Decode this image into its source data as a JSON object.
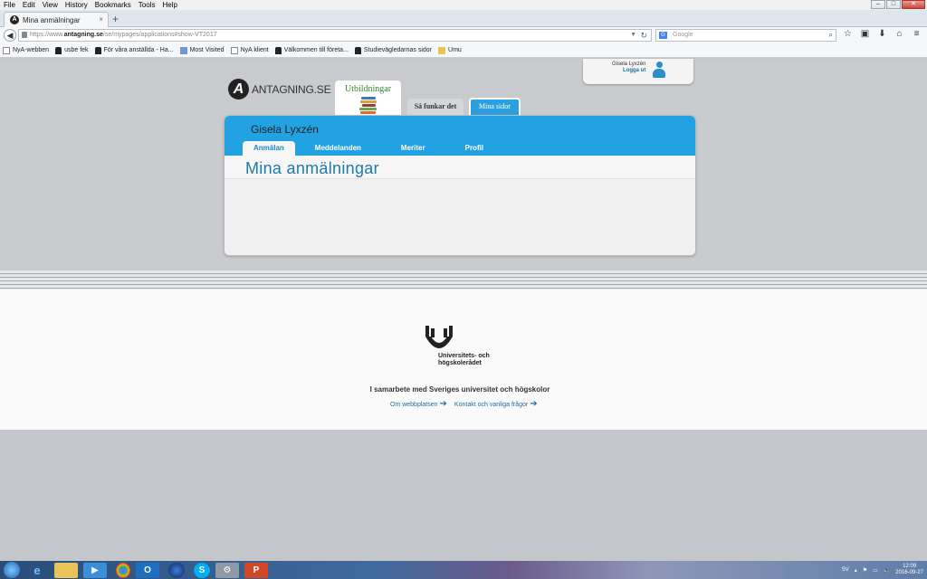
{
  "menu": [
    "File",
    "Edit",
    "View",
    "History",
    "Bookmarks",
    "Tools",
    "Help"
  ],
  "window_controls": {
    "minimize": "–",
    "maximize": "□",
    "close": "✕"
  },
  "browser": {
    "tab_title": "Mina anmälningar",
    "tab_close": "×",
    "new_tab": "+",
    "url_prefix": "https://www.",
    "url_domain": "antagning.se",
    "url_path": "/se/mypages/applications#show-VT2017",
    "search_placeholder": "Google",
    "search_engine_icon": "G"
  },
  "bookmarks": [
    {
      "label": "NyA-webben",
      "icon": "page"
    },
    {
      "label": "usbe fek",
      "icon": "hat"
    },
    {
      "label": "För våra anställda - Ha...",
      "icon": "hat"
    },
    {
      "label": "Most Visited",
      "icon": "blue"
    },
    {
      "label": "NyA klient",
      "icon": "page"
    },
    {
      "label": "Välkommen till företa...",
      "icon": "hat"
    },
    {
      "label": "Studievägledarnas sidor",
      "icon": "hat"
    },
    {
      "label": "Umu",
      "icon": "folder"
    }
  ],
  "site": {
    "logo_letter": "A",
    "logo_text": "ANTAGNING.SE",
    "user_name": "Gisela Lyxzén",
    "logout": "Logga ut",
    "tabs": {
      "utbildningar": "Utbildningar",
      "sa_funkar": "Så funkar det",
      "mina_sidor": "Mina sidor"
    },
    "panel_name": "Gisela Lyxzén",
    "subtabs": [
      "Anmälan",
      "Meddelanden",
      "Meriter",
      "Profil"
    ],
    "panel_title": "Mina anmälningar"
  },
  "footer": {
    "org_line1": "Universitets- och",
    "org_line2": "högskolerådet",
    "collab": "I samarbete med Sveriges universitet och högskolor",
    "link1": "Om webbplatsen",
    "link2": "Kontakt och vanliga frågor"
  },
  "taskbar": {
    "lang": "SV",
    "time": "12:09",
    "date": "2016-09-27"
  }
}
